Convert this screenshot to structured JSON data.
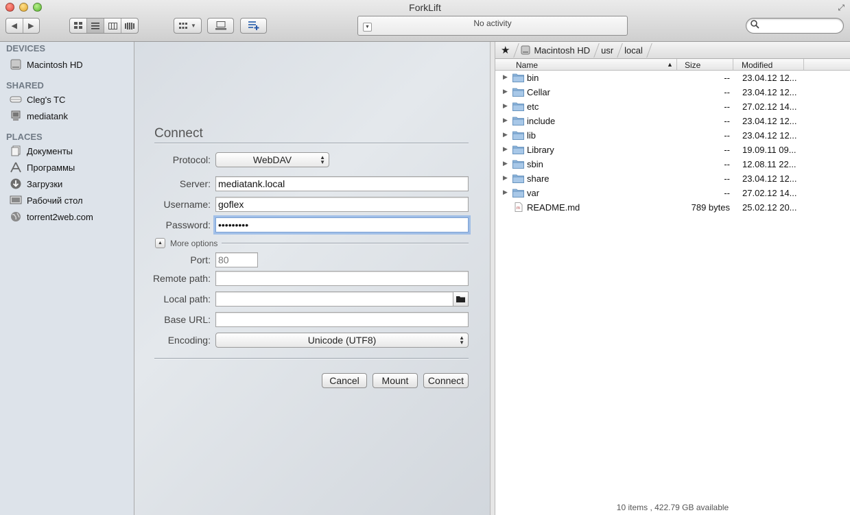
{
  "window": {
    "title": "ForkLift"
  },
  "toolbar": {
    "activity": "No activity",
    "search_placeholder": ""
  },
  "sidebar": {
    "sections": [
      {
        "heading": "DEVICES",
        "items": [
          {
            "label": "Macintosh HD",
            "icon": "hard-drive-icon"
          }
        ]
      },
      {
        "heading": "SHARED",
        "items": [
          {
            "label": "Cleg's TC",
            "icon": "time-capsule-icon"
          },
          {
            "label": "mediatank",
            "icon": "network-computer-icon"
          }
        ]
      },
      {
        "heading": "PLACES",
        "items": [
          {
            "label": "Документы",
            "icon": "documents-icon"
          },
          {
            "label": "Программы",
            "icon": "applications-icon"
          },
          {
            "label": "Загрузки",
            "icon": "downloads-icon"
          },
          {
            "label": "Рабочий стол",
            "icon": "desktop-icon"
          },
          {
            "label": "torrent2web.com",
            "icon": "globe-icon"
          }
        ]
      }
    ]
  },
  "connect": {
    "title": "Connect",
    "protocol_label": "Protocol:",
    "protocol_value": "WebDAV",
    "server_label": "Server:",
    "server_value": "mediatank.local",
    "username_label": "Username:",
    "username_value": "goflex",
    "password_label": "Password:",
    "password_value": "•••••••••",
    "more_options": "More options",
    "port_label": "Port:",
    "port_value": "80",
    "remote_label": "Remote path:",
    "remote_value": "",
    "local_label": "Local path:",
    "local_value": "",
    "base_label": "Base URL:",
    "base_value": "",
    "encoding_label": "Encoding:",
    "encoding_value": "Unicode (UTF8)",
    "cancel": "Cancel",
    "mount": "Mount",
    "connect": "Connect"
  },
  "pane": {
    "path": [
      "Macintosh HD",
      "usr",
      "local"
    ],
    "columns": {
      "name": "Name",
      "size": "Size",
      "modified": "Modified"
    },
    "rows": [
      {
        "name": "bin",
        "size": "--",
        "modified": "23.04.12 12...",
        "kind": "folder"
      },
      {
        "name": "Cellar",
        "size": "--",
        "modified": "23.04.12 12...",
        "kind": "folder"
      },
      {
        "name": "etc",
        "size": "--",
        "modified": "27.02.12 14...",
        "kind": "folder"
      },
      {
        "name": "include",
        "size": "--",
        "modified": "23.04.12 12...",
        "kind": "folder"
      },
      {
        "name": "lib",
        "size": "--",
        "modified": "23.04.12 12...",
        "kind": "folder"
      },
      {
        "name": "Library",
        "size": "--",
        "modified": "19.09.11 09...",
        "kind": "folder"
      },
      {
        "name": "sbin",
        "size": "--",
        "modified": "12.08.11 22...",
        "kind": "folder"
      },
      {
        "name": "share",
        "size": "--",
        "modified": "23.04.12 12...",
        "kind": "folder"
      },
      {
        "name": "var",
        "size": "--",
        "modified": "27.02.12 14...",
        "kind": "folder"
      },
      {
        "name": "README.md",
        "size": "789 bytes",
        "modified": "25.02.12 20...",
        "kind": "file"
      }
    ],
    "status": "10 items , 422.79 GB available"
  },
  "colors": {
    "sidebar_bg": "#dde3ea",
    "folder": "#8fb6dc",
    "focus_ring": "#6ea0e6"
  }
}
